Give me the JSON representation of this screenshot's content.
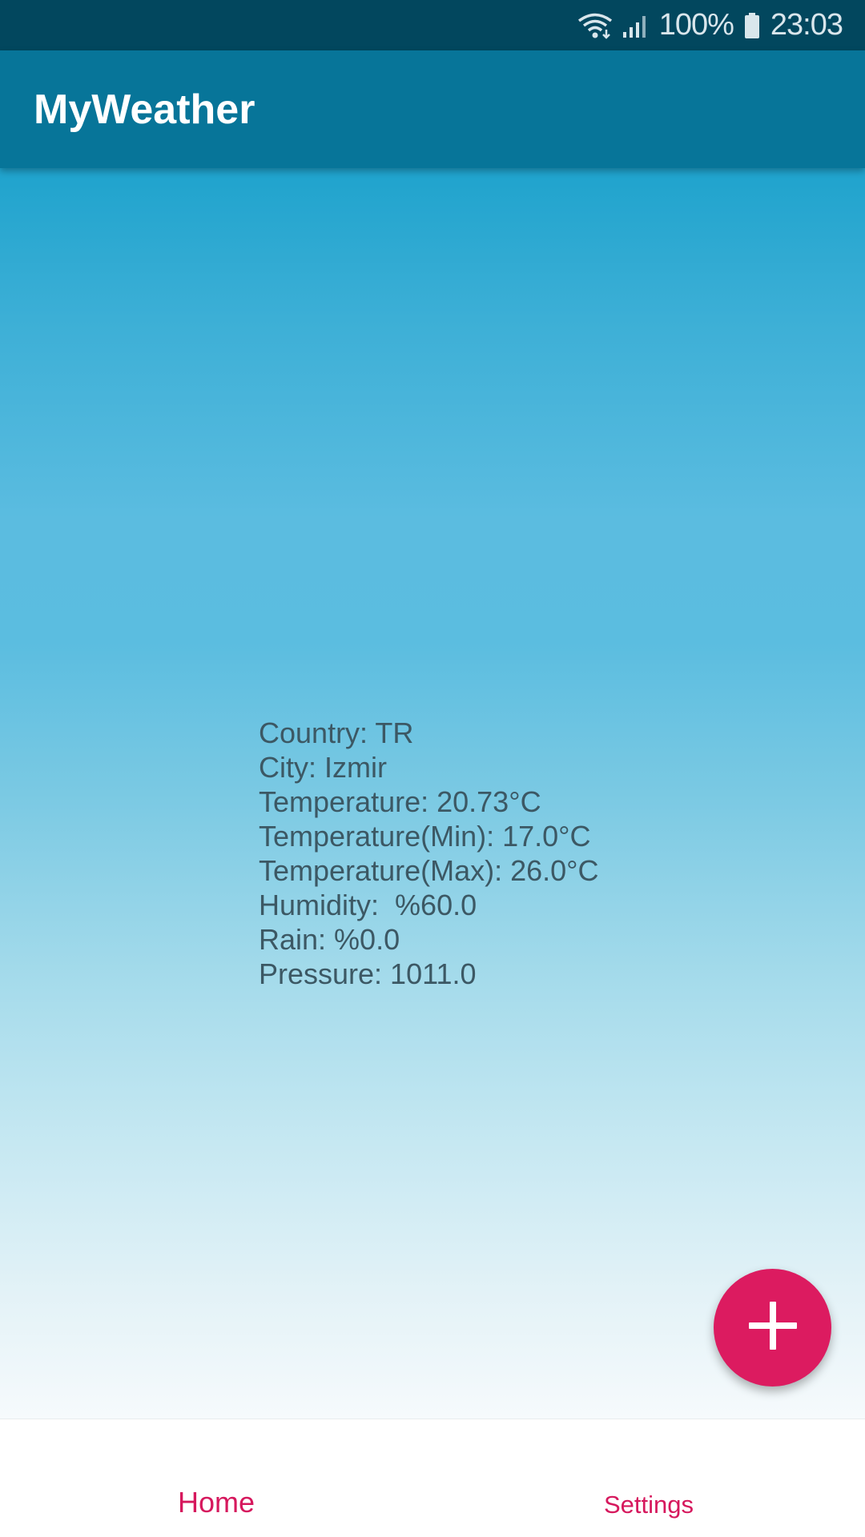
{
  "status_bar": {
    "battery": "100%",
    "time": "23:03",
    "icons": [
      "wifi-icon",
      "signal-icon",
      "battery-icon"
    ]
  },
  "app_bar": {
    "title": "MyWeather"
  },
  "weather": {
    "country": "Country: TR",
    "city": "City: Izmir",
    "temperature": "Temperature: 20.73°C",
    "temperature_min": "Temperature(Min): 17.0°C",
    "temperature_max": "Temperature(Max): 26.0°C",
    "humidity": "Humidity:  %60.0",
    "rain": "Rain: %0.0",
    "pressure": "Pressure: 1011.0"
  },
  "fab": {
    "icon": "plus-icon"
  },
  "bottom_nav": {
    "items": [
      {
        "label": "Home",
        "active": true
      },
      {
        "label": "Settings",
        "active": false
      }
    ]
  },
  "colors": {
    "status_bar": "#02475e",
    "app_bar": "#077599",
    "accent": "#dc1b60",
    "text": "#3c5864"
  }
}
